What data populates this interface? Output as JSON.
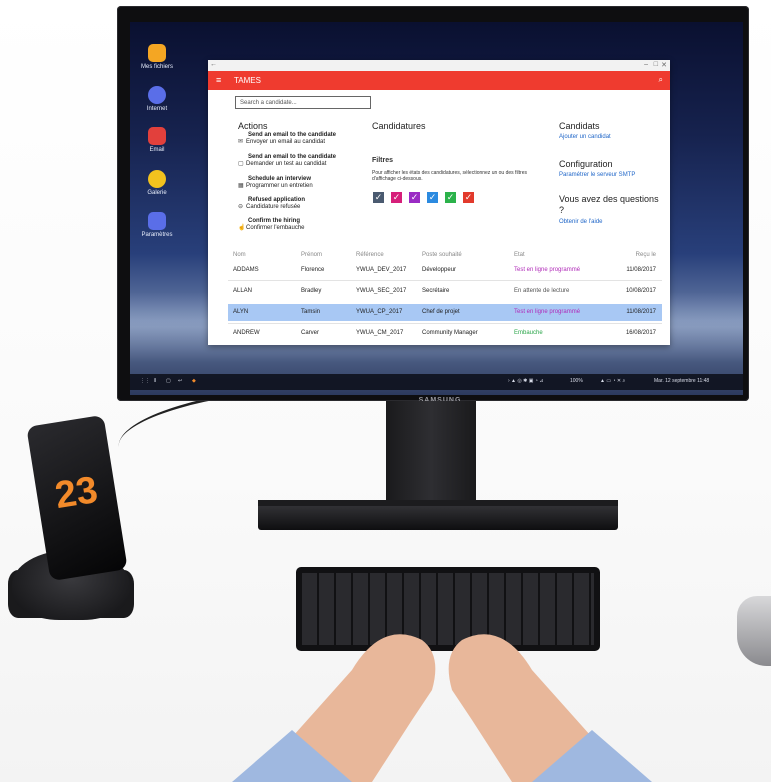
{
  "desktop": {
    "icons": [
      {
        "label": "Mes fichiers",
        "color": "#f4a623"
      },
      {
        "label": "Internet",
        "color": "#5a6ee8"
      },
      {
        "label": "Email",
        "color": "#e2403c"
      },
      {
        "label": "Galerie",
        "color": "#f2c21e"
      },
      {
        "label": "Paramètres",
        "color": "#5a6ee8"
      }
    ]
  },
  "window": {
    "titlebar_controls": [
      "–",
      "□",
      "✕"
    ],
    "app_title": "TAMES",
    "search_placeholder": "Search a candidate..."
  },
  "actions": {
    "heading": "Actions",
    "items": [
      {
        "en": "Send an email to the candidate",
        "fr": "Envoyer un email au candidat",
        "icon": "mail-icon"
      },
      {
        "en": "Send an email to the candidate",
        "fr": "Demander un test au candidat",
        "icon": "test-icon"
      },
      {
        "en": "Schedule an interview",
        "fr": "Programmer un entretien",
        "icon": "calendar-icon"
      },
      {
        "en": "Refused application",
        "fr": "Candidature refusée",
        "icon": "refuse-icon"
      },
      {
        "en": "Confirm the hiring",
        "fr": "Confirmer l'embauche",
        "icon": "thumb-up-icon"
      }
    ]
  },
  "candidatures": {
    "heading": "Candidatures",
    "filters_heading": "Filtres",
    "filters_text": "Pour afficher les états des candidatures, sélectionnez un ou des filtres d'affichage ci-dessous.",
    "filter_colors": [
      "#4a5a70",
      "#d61f7a",
      "#9a2bc4",
      "#2b8ae0",
      "#2bb24a",
      "#e23a2c"
    ]
  },
  "sidebar": {
    "candidats_heading": "Candidats",
    "candidats_link": "Ajouter un candidat",
    "config_heading": "Configuration",
    "config_link": "Paramétrer le serveur SMTP",
    "help_heading": "Vous avez des questions ?",
    "help_link": "Obtenir de l'aide"
  },
  "table": {
    "headers": [
      "Nom",
      "Prénom",
      "Référence",
      "Poste souhaité",
      "Etat",
      "Reçu le"
    ],
    "rows": [
      {
        "nom": "ADDAMS",
        "prenom": "Florence",
        "ref": "YWUA_DEV_2017",
        "poste": "Développeur",
        "etat": "Test en ligne programmé",
        "etat_color": "#b02ab8",
        "date": "11/08/2017",
        "selected": false
      },
      {
        "nom": "ALLAN",
        "prenom": "Bradley",
        "ref": "YWUA_SEC_2017",
        "poste": "Secrétaire",
        "etat": "En attente de lecture",
        "etat_color": "#555555",
        "date": "10/08/2017",
        "selected": false
      },
      {
        "nom": "ALYN",
        "prenom": "Tamsin",
        "ref": "YWUA_CP_2017",
        "poste": "Chef de projet",
        "etat": "Test en ligne programmé",
        "etat_color": "#b02ab8",
        "date": "11/08/2017",
        "selected": true
      },
      {
        "nom": "ANDREW",
        "prenom": "Carver",
        "ref": "YWUA_CM_2017",
        "poste": "Community Manager",
        "etat": "Embauche",
        "etat_color": "#2ba64a",
        "date": "16/08/2017",
        "selected": false
      }
    ]
  },
  "taskbar": {
    "battery": "100%",
    "datetime": "Mar. 12 septembre 11:48"
  },
  "monitor": {
    "brand": "SAMSUNG"
  },
  "phone": {
    "logo_text": "23"
  }
}
